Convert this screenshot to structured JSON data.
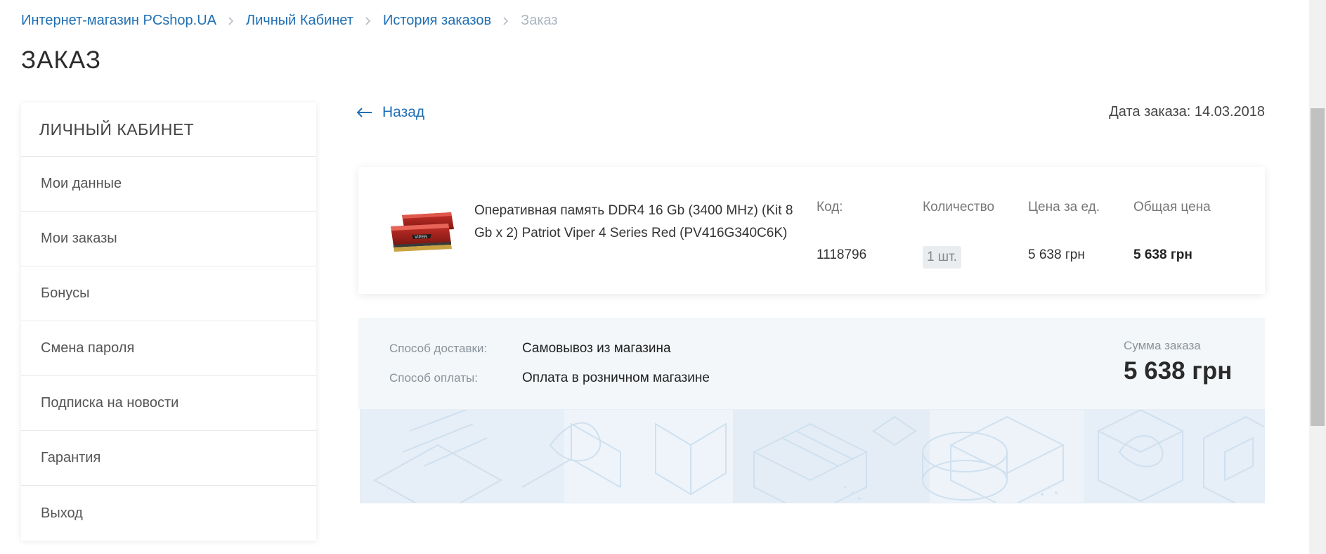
{
  "breadcrumb": {
    "items": [
      "Интернет-магазин PCshop.UA",
      "Личный Кабинет",
      "История заказов"
    ],
    "current": "Заказ"
  },
  "page": {
    "title": "ЗАКАЗ"
  },
  "sidebar": {
    "title": "ЛИЧНЫЙ КАБИНЕТ",
    "items": [
      {
        "label": "Мои данные"
      },
      {
        "label": "Мои заказы"
      },
      {
        "label": "Бонусы"
      },
      {
        "label": "Смена пароля"
      },
      {
        "label": "Подписка на новости"
      },
      {
        "label": "Гарантия"
      },
      {
        "label": "Выход"
      }
    ]
  },
  "order": {
    "back_label": "Назад",
    "date_text": "Дата заказа: 14.03.2018",
    "columns": {
      "code": "Код:",
      "quantity": "Количество",
      "unit_price": "Цена за ед.",
      "total_price": "Общая цена"
    },
    "product": {
      "name": "Оперативная память DDR4 16 Gb (3400 MHz) (Kit 8 Gb x 2) Patriot Viper 4 Series Red (PV416G340C6K)",
      "code": "1118796",
      "quantity": "1 шт.",
      "unit_price": "5 638 грн",
      "total_price": "5 638 грн",
      "image_icon": "ram-module-image"
    },
    "delivery_label": "Способ доставки:",
    "delivery_value": "Самовывоз из магазина",
    "payment_label": "Способ оплаты:",
    "payment_value": "Оплата в розничном магазине",
    "sum_label": "Сумма заказа",
    "sum_value": "5 638 грн"
  },
  "colors": {
    "link": "#1f6fb4",
    "breadcrumb_current": "#a9b6c2",
    "summary_bg": "#f3f7fa",
    "illustration": "#cfe0ef"
  }
}
